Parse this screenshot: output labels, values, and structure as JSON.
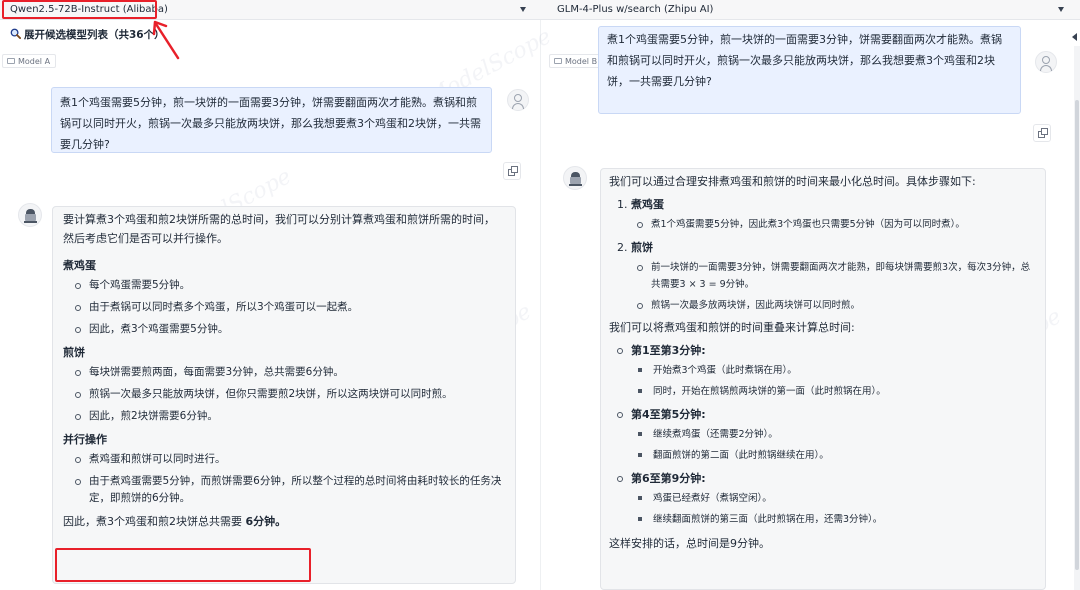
{
  "model_selector": {
    "a": {
      "label": "Qwen2.5-72B-Instruct (Alibaba)"
    },
    "b": {
      "label": "GLM-4-Plus w/search (Zhipu AI)"
    }
  },
  "expand_candidates": {
    "label": "展开候选模型列表（共36个）"
  },
  "panels": {
    "a": {
      "label": "Model A"
    },
    "b": {
      "label": "Model B"
    }
  },
  "watermark": "ModelScope",
  "question": {
    "a": "煮1个鸡蛋需要5分钟，煎一块饼的一面需要3分钟，饼需要翻面两次才能熟。煮锅和煎锅可以同时开火，煎锅一次最多只能放两块饼，那么我想要煮3个鸡蛋和2块饼，一共需要几分钟?",
    "b": "煮1个鸡蛋需要5分钟，煎一块饼的一面需要3分钟，饼需要翻面两次才能熟。煮锅和煎锅可以同时开火，煎锅一次最多只能放两块饼，那么我想要煮3个鸡蛋和2块饼，一共需要几分钟?"
  },
  "answer_a": {
    "intro": "要计算煮3个鸡蛋和煎2块饼所需的总时间，我们可以分别计算煮鸡蛋和煎饼所需的时间，然后考虑它们是否可以并行操作。",
    "sections": [
      {
        "title": "煮鸡蛋",
        "items": [
          "每个鸡蛋需要5分钟。",
          "由于煮锅可以同时煮多个鸡蛋，所以3个鸡蛋可以一起煮。",
          "因此，煮3个鸡蛋需要5分钟。"
        ]
      },
      {
        "title": "煎饼",
        "items": [
          "每块饼需要煎两面，每面需要3分钟，总共需要6分钟。",
          "煎锅一次最多只能放两块饼，但你只需要煎2块饼，所以这两块饼可以同时煎。",
          "因此，煎2块饼需要6分钟。"
        ]
      },
      {
        "title": "并行操作",
        "items": [
          "煮鸡蛋和煎饼可以同时进行。",
          "由于煮鸡蛋需要5分钟，而煎饼需要6分钟，所以整个过程的总时间将由耗时较长的任务决定，即煎饼的6分钟。"
        ]
      }
    ],
    "final_prefix": "因此，煮3个鸡蛋和煎2块饼总共需要 ",
    "final_bold": "6分钟。"
  },
  "answer_b": {
    "intro": "我们可以通过合理安排煮鸡蛋和煎饼的时间来最小化总时间。具体步骤如下:",
    "steps": [
      {
        "num": "1.",
        "title": "煮鸡蛋",
        "items": [
          "煮1个鸡蛋需要5分钟，因此煮3个鸡蛋也只需要5分钟（因为可以同时煮）。"
        ]
      },
      {
        "num": "2.",
        "title": "煎饼",
        "items": [
          "前一块饼的一面需要3分钟，饼需要翻面两次才能熟，即每块饼需要煎3次，每次3分钟，总共需要3 × 3 = 9分钟。",
          "煎锅一次最多放两块饼，因此两块饼可以同时煎。"
        ]
      }
    ],
    "para": "我们可以将煮鸡蛋和煎饼的时间重叠来计算总时间:",
    "phases": [
      {
        "title": "第1至第3分钟:",
        "items": [
          "开始煮3个鸡蛋（此时煮锅在用）。",
          "同时，开始在煎锅煎两块饼的第一面（此时煎锅在用）。"
        ]
      },
      {
        "title": "第4至第5分钟:",
        "items": [
          "继续煮鸡蛋（还需要2分钟）。",
          "翻面煎饼的第二面（此时煎锅继续在用）。"
        ]
      },
      {
        "title": "第6至第9分钟:",
        "items": [
          "鸡蛋已经煮好（煮锅空闲）。",
          "继续翻面煎饼的第三面（此时煎锅在用，还需3分钟）。"
        ]
      }
    ],
    "conclusion": "这样安排的话，总时间是9分钟。"
  },
  "colors": {
    "highlight": "#e8202a",
    "user_bubble": "#eaf1ff",
    "bot_bubble": "#f6f7f8"
  }
}
